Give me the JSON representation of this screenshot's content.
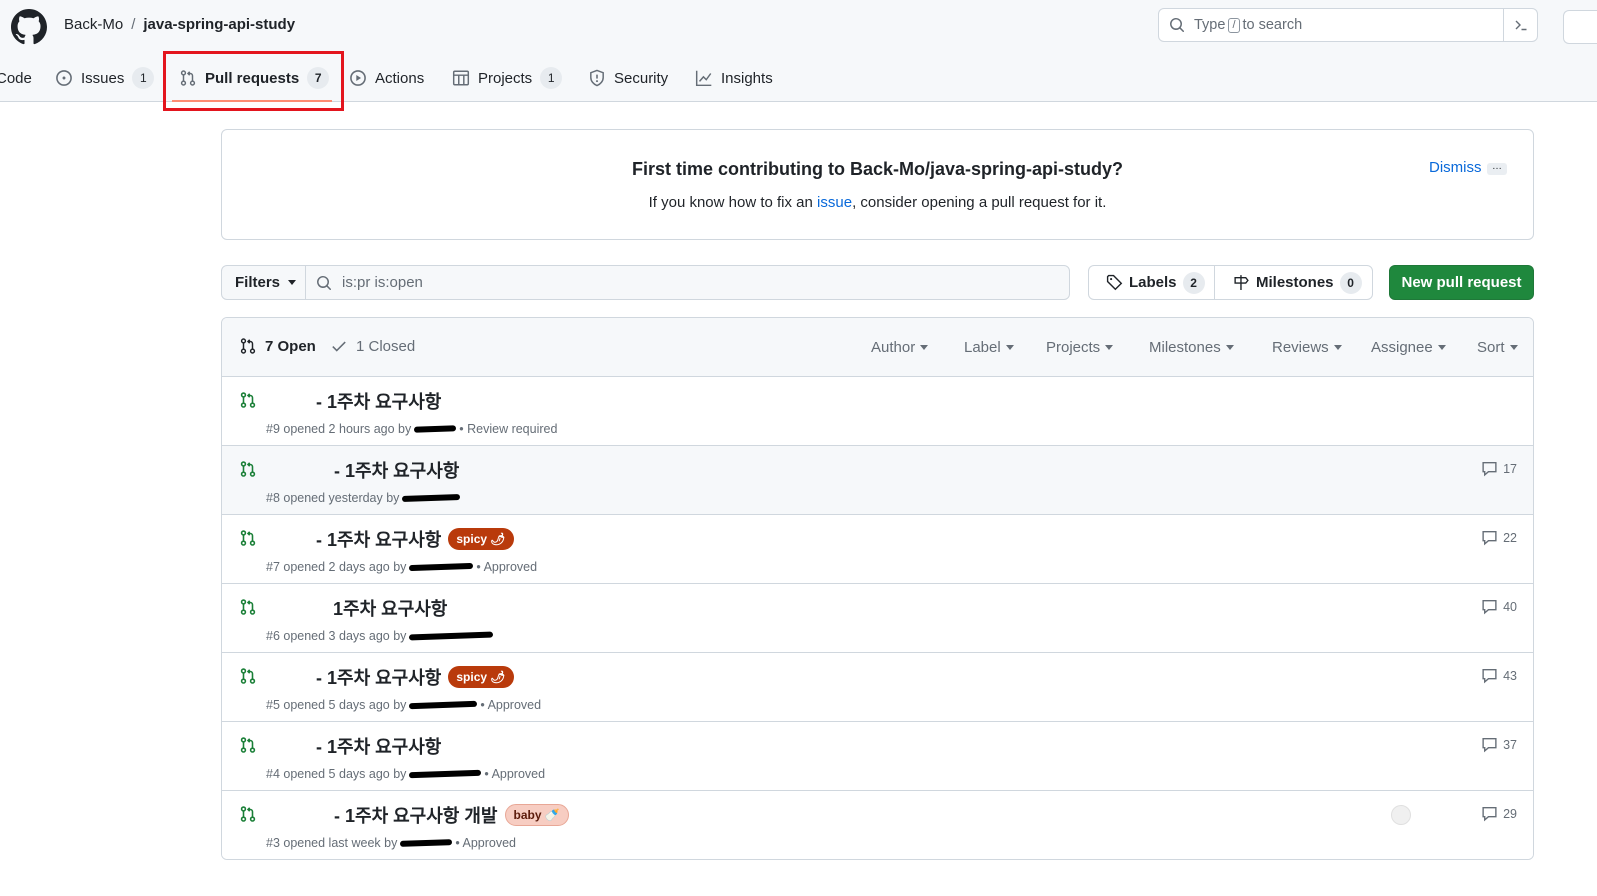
{
  "header": {
    "owner": "Back-Mo",
    "separator": "/",
    "repo": "java-spring-api-study",
    "search_prefix": "Type",
    "search_key": "/",
    "search_suffix": "to search",
    "command_icon": "terminal-icon"
  },
  "tabs": [
    {
      "label": "Code",
      "icon": "code-icon"
    },
    {
      "label": "Issues",
      "count": "1",
      "icon": "issue-icon"
    },
    {
      "label": "Pull requests",
      "count": "7",
      "icon": "pull-request-icon"
    },
    {
      "label": "Actions",
      "icon": "play-icon"
    },
    {
      "label": "Projects",
      "count": "1",
      "icon": "table-icon"
    },
    {
      "label": "Security",
      "icon": "shield-icon"
    },
    {
      "label": "Insights",
      "icon": "graph-icon"
    }
  ],
  "banner": {
    "title": "First time contributing to Back-Mo/java-spring-api-study?",
    "sub_before": "If you know how to fix an",
    "sub_link": "issue",
    "sub_after": ", consider opening a pull request for it.",
    "dismiss": "Dismiss",
    "more": "…"
  },
  "filterbar": {
    "filters_label": "Filters",
    "query": "is:pr is:open",
    "labels_label": "Labels",
    "labels_count": "2",
    "milestones_label": "Milestones",
    "milestones_count": "0",
    "new_pr_label": "New pull request"
  },
  "list_header": {
    "open_label": "7 Open",
    "closed_label": "1 Closed",
    "sort_items": [
      "Author",
      "Label",
      "Projects",
      "Milestones",
      "Reviews",
      "Assignee",
      "Sort"
    ]
  },
  "pull_requests": [
    {
      "title": "- 1주차 요구사항",
      "meta_before": "#9 opened 2 hours ago by",
      "meta_after": "• Review required",
      "comments": ""
    },
    {
      "title": "- 1주차 요구사항",
      "meta_before": "#8 opened yesterday by",
      "meta_after": "",
      "comments": "17"
    },
    {
      "title": "- 1주차 요구사항",
      "label": "spicy 🌶",
      "meta_before": "#7 opened 2 days ago by",
      "meta_after": "• Approved",
      "comments": "22"
    },
    {
      "title": "1주차 요구사항",
      "meta_before": "#6 opened 3 days ago by",
      "meta_after": "",
      "comments": "40"
    },
    {
      "title": "- 1주차 요구사항",
      "label": "spicy 🌶",
      "meta_before": "#5 opened 5 days ago by",
      "meta_after": "• Approved",
      "comments": "43"
    },
    {
      "title": "- 1주차 요구사항",
      "meta_before": "#4 opened 5 days ago by",
      "meta_after": "• Approved",
      "comments": "37"
    },
    {
      "title": "- 1주차 요구사항 개발",
      "label": "baby 🍼",
      "meta_before": "#3 opened last week by",
      "meta_after": "• Approved",
      "comments": "29"
    }
  ],
  "colors": {
    "accent_green": "#1f883d",
    "link_blue": "#0969da",
    "highlight_red": "#e3151e",
    "tab_underline": "#fd8c73"
  }
}
